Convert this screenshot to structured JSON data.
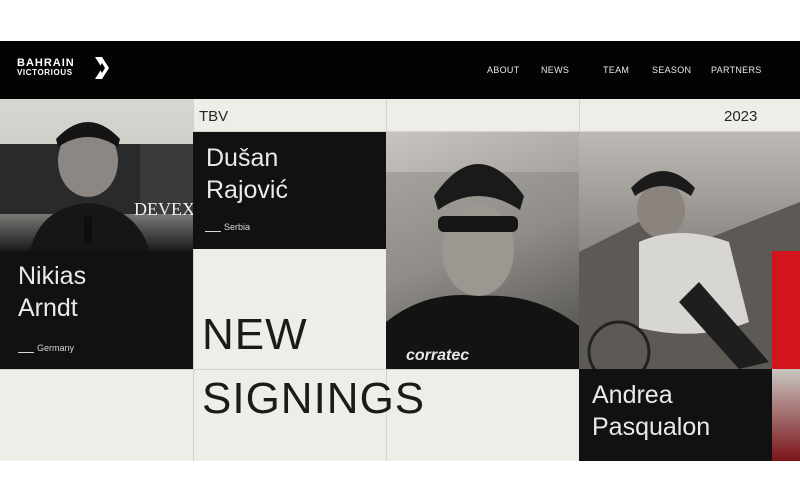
{
  "header": {
    "logo": {
      "line1": "BAHRAIN",
      "line2": "VICTORIOUS"
    },
    "nav": [
      {
        "label": "ABOUT"
      },
      {
        "label": "NEWS"
      },
      {
        "label": "TEAM"
      },
      {
        "label": "SEASON"
      },
      {
        "label": "PARTNERS"
      }
    ]
  },
  "hero": {
    "tag": "TBV",
    "year": "2023",
    "headline": {
      "line1": "NEW",
      "line2": "SIGNINGS"
    },
    "riders": [
      {
        "first": "Nikias",
        "last": "Arndt",
        "country": "Germany"
      },
      {
        "first": "Dušan",
        "last": "Rajović",
        "country": "Serbia"
      },
      {
        "first": "Andrea",
        "last": "Pasqualon",
        "country": ""
      }
    ],
    "photo_texts": {
      "sponsor_banner": "DEVEX",
      "jersey": "corratec"
    }
  },
  "colors": {
    "black": "#111111",
    "background": "#efede8",
    "accent": "#d4141c"
  }
}
